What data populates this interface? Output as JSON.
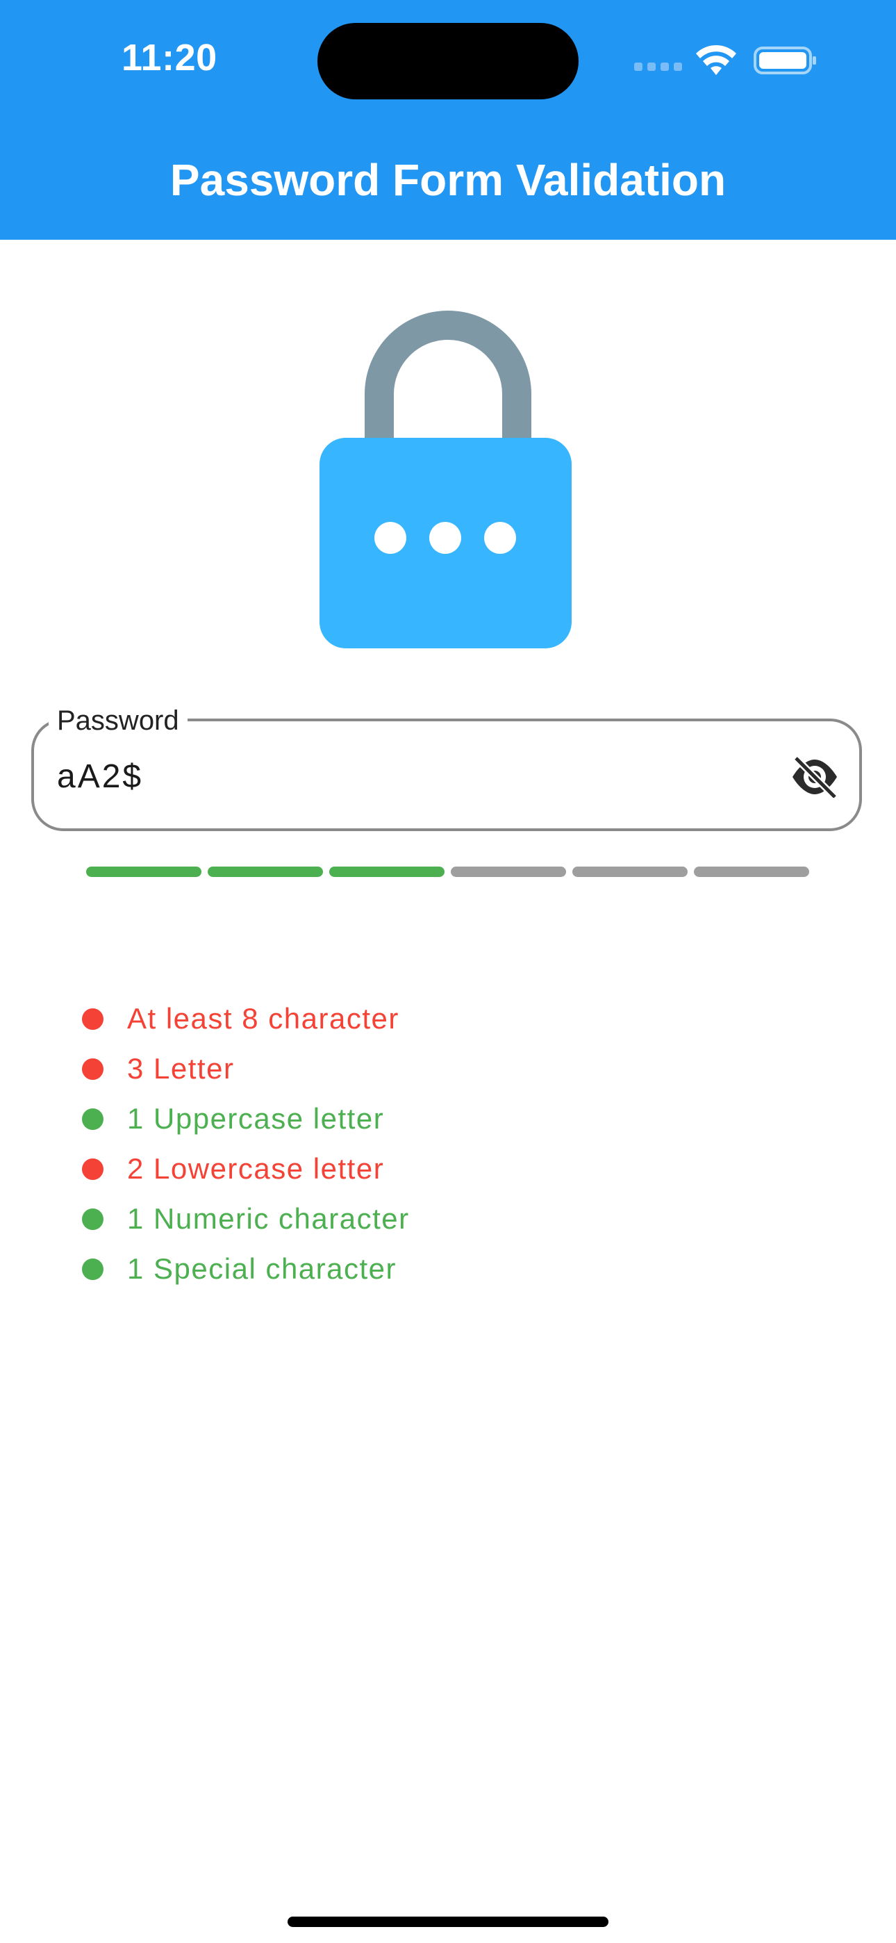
{
  "status_bar": {
    "time": "11:20"
  },
  "app_bar": {
    "title": "Password Form Validation"
  },
  "password_field": {
    "label": "Password",
    "value": "aA2$",
    "toggle_icon": "visibility-off-icon"
  },
  "strength_meter": {
    "total_segments": 6,
    "filled_segments": 3
  },
  "rules": [
    {
      "text": "At least 8 character",
      "met": false
    },
    {
      "text": "3 Letter",
      "met": false
    },
    {
      "text": "1 Uppercase letter",
      "met": true
    },
    {
      "text": "2 Lowercase letter",
      "met": false
    },
    {
      "text": "1 Numeric character",
      "met": true
    },
    {
      "text": "1 Special character",
      "met": true
    }
  ],
  "colors": {
    "app_bar": "#2196f3",
    "met": "#4caf50",
    "unmet": "#f44336",
    "lock_body": "#37b6ff",
    "lock_shackle": "#7f98a5",
    "meter_off": "#9e9e9e"
  }
}
